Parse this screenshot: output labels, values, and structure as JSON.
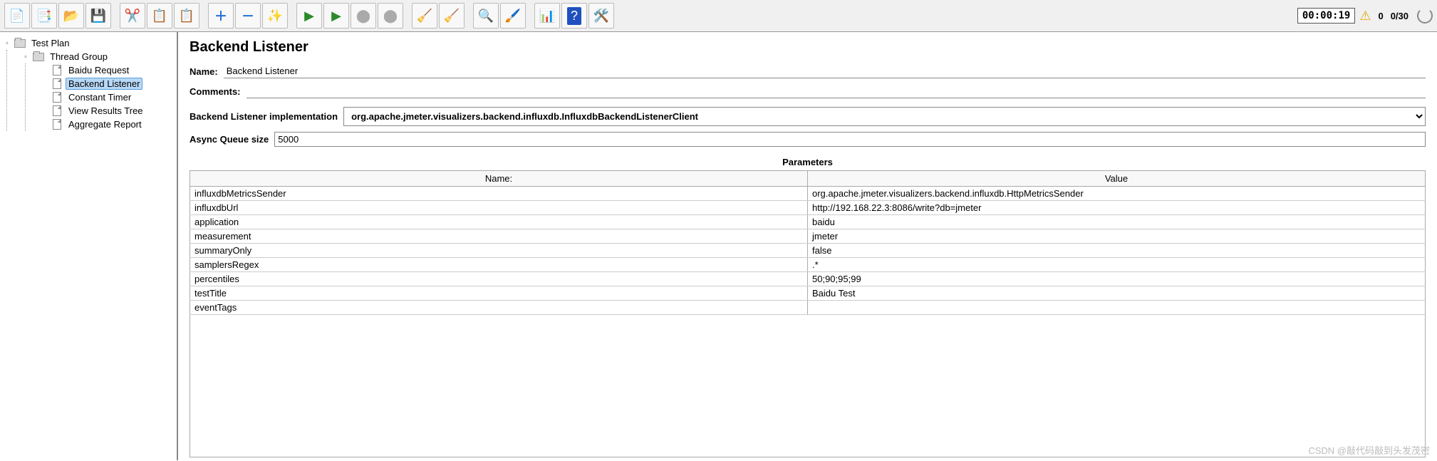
{
  "toolbar": {
    "timer": "00:00:19",
    "active_threads": "0",
    "thread_ratio": "0/30"
  },
  "tree": {
    "root": "Test Plan",
    "thread_group": "Thread Group",
    "items": [
      "Baidu Request",
      "Backend Listener",
      "Constant Timer",
      "View Results Tree",
      "Aggregate Report"
    ],
    "selected_index": 1
  },
  "config": {
    "title": "Backend Listener",
    "name_label": "Name:",
    "name_value": "Backend Listener",
    "comments_label": "Comments:",
    "comments_value": "",
    "impl_label": "Backend Listener implementation",
    "impl_value": "org.apache.jmeter.visualizers.backend.influxdb.InfluxdbBackendListenerClient",
    "queue_label": "Async Queue size",
    "queue_value": "5000",
    "params_title": "Parameters",
    "col_name": "Name:",
    "col_value": "Value",
    "params": [
      {
        "name": "influxdbMetricsSender",
        "value": "org.apache.jmeter.visualizers.backend.influxdb.HttpMetricsSender"
      },
      {
        "name": "influxdbUrl",
        "value": "http://192.168.22.3:8086/write?db=jmeter"
      },
      {
        "name": "application",
        "value": "baidu"
      },
      {
        "name": "measurement",
        "value": "jmeter"
      },
      {
        "name": "summaryOnly",
        "value": "false"
      },
      {
        "name": "samplersRegex",
        "value": ".*"
      },
      {
        "name": "percentiles",
        "value": "50;90;95;99"
      },
      {
        "name": "testTitle",
        "value": "Baidu Test"
      },
      {
        "name": "eventTags",
        "value": ""
      }
    ]
  },
  "watermark": "CSDN @敲代码敲到头发茂密"
}
